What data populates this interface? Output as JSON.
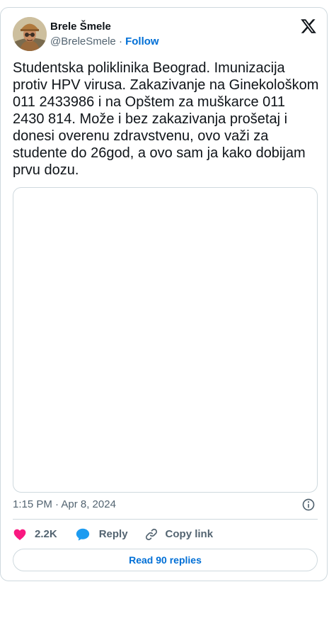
{
  "author": {
    "name": "Brele Šmele",
    "handle": "@BreleSmele",
    "separator": "·",
    "follow_label": "Follow"
  },
  "tweet": {
    "text": "Studentska poliklinika Beograd. Imunizacija protiv HPV virusa. Zakazivanje na Ginekološkom 011 2433986 i na Opštem za muškarce 011 2430 814. Može i bez zakazivanja prošetaj i donesi overenu zdravstvenu, ovo važi za studente do 26god, a ovo sam ja kako dobijam prvu dozu.",
    "timestamp": "1:15 PM · Apr 8, 2024"
  },
  "actions": {
    "like_count": "2.2K",
    "reply_label": "Reply",
    "copy_label": "Copy link"
  },
  "read_replies_label": "Read 90 replies",
  "icons": {
    "logo": "x-logo-icon",
    "info": "info-icon",
    "like": "heart-icon",
    "reply": "speech-bubble-icon",
    "copy": "link-icon"
  },
  "colors": {
    "link_blue": "#006fd6",
    "like_pink": "#f91880",
    "reply_blue": "#1d9bf0",
    "secondary_text": "#536471",
    "border": "#cfd9de"
  }
}
